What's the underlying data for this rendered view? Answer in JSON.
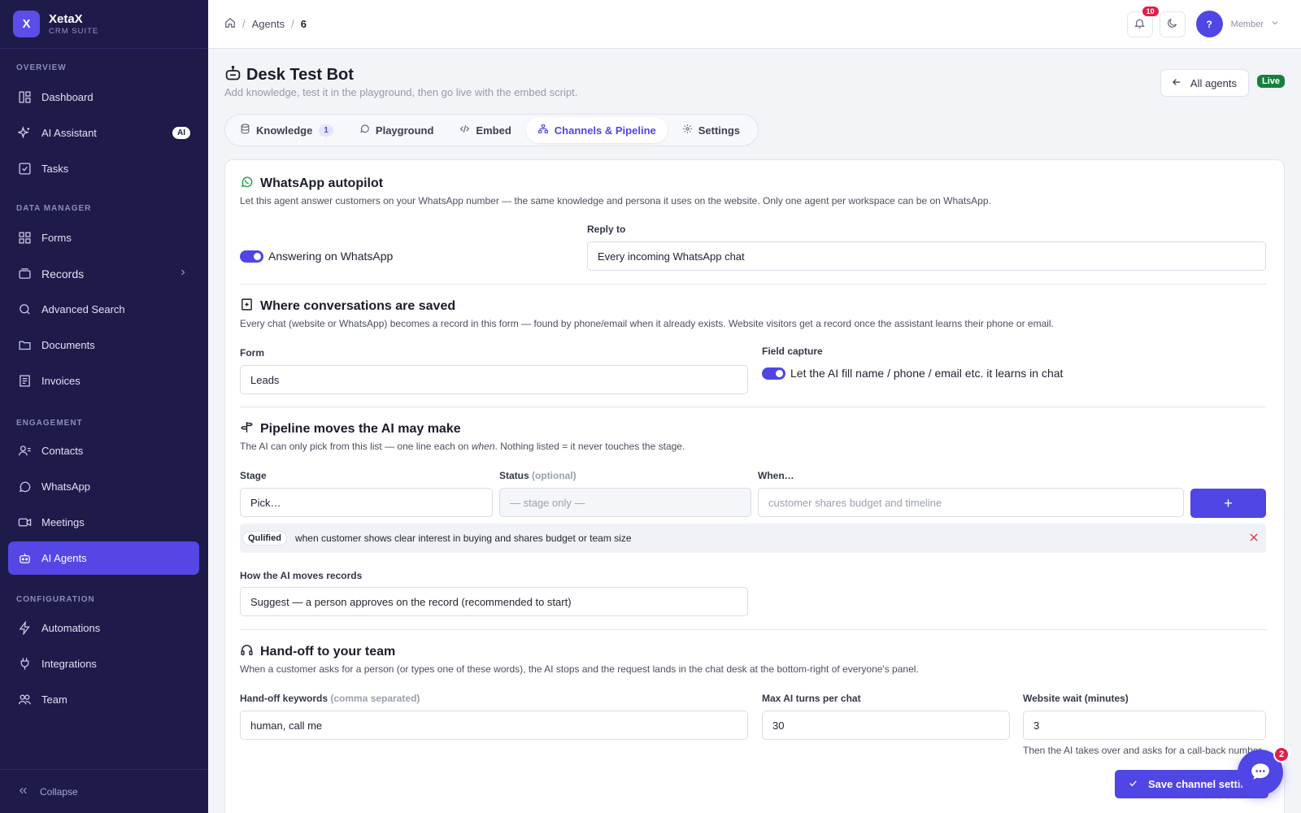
{
  "brand": {
    "logo_letter": "X",
    "name": "XetaX",
    "subtitle": "CRM SUITE"
  },
  "sidebar": {
    "sections": [
      {
        "label": "OVERVIEW"
      },
      {
        "label": "DATA MANAGER"
      },
      {
        "label": "ENGAGEMENT"
      },
      {
        "label": "CONFIGURATION"
      }
    ],
    "items": [
      {
        "label": "Dashboard",
        "icon": "dashboard-icon"
      },
      {
        "label": "AI Assistant",
        "icon": "sparkles-icon",
        "badge": "AI"
      },
      {
        "label": "Tasks",
        "icon": "checkbox-icon"
      },
      {
        "label": "Forms",
        "icon": "forms-icon"
      },
      {
        "label": "Records",
        "icon": "records-icon"
      },
      {
        "label": "Advanced Search",
        "icon": "search-icon"
      },
      {
        "label": "Documents",
        "icon": "folder-icon"
      },
      {
        "label": "Invoices",
        "icon": "invoice-icon"
      },
      {
        "label": "Contacts",
        "icon": "contacts-icon"
      },
      {
        "label": "WhatsApp",
        "icon": "whatsapp-icon"
      },
      {
        "label": "Meetings",
        "icon": "video-icon"
      },
      {
        "label": "AI Agents",
        "icon": "robot-icon",
        "active": true
      },
      {
        "label": "Automations",
        "icon": "bolt-icon"
      },
      {
        "label": "Integrations",
        "icon": "plug-icon"
      },
      {
        "label": "Team",
        "icon": "team-icon"
      }
    ],
    "collapse_label": "Collapse"
  },
  "topbar": {
    "breadcrumb": [
      "Agents",
      "6"
    ],
    "notifications_count": "10",
    "avatar_letter": "?",
    "role": "Member"
  },
  "page": {
    "title": "Desk Test Bot",
    "subtitle": "Add knowledge, test it in the playground, then go live with the embed script.",
    "all_agents_label": "All agents",
    "status": "Live",
    "tabs": [
      {
        "label": "Knowledge",
        "count": "1",
        "icon": "database-icon"
      },
      {
        "label": "Playground",
        "icon": "chat-bubble-icon"
      },
      {
        "label": "Embed",
        "icon": "code-icon"
      },
      {
        "label": "Channels & Pipeline",
        "icon": "hierarchy-icon",
        "active": true
      },
      {
        "label": "Settings",
        "icon": "gear-icon"
      }
    ]
  },
  "whatsapp": {
    "title": "WhatsApp autopilot",
    "description": "Let this agent answer customers on your WhatsApp number — the same knowledge and persona it uses on the website. Only one agent per workspace can be on WhatsApp.",
    "toggle_label": "Answering on WhatsApp",
    "toggle_on": true,
    "reply_to_label": "Reply to",
    "reply_to_value": "Every incoming WhatsApp chat"
  },
  "conversations": {
    "title": "Where conversations are saved",
    "description": "Every chat (website or WhatsApp) becomes a record in this form — found by phone/email when it already exists. Website visitors get a record once the assistant learns their phone or email.",
    "form_label": "Form",
    "form_value": "Leads",
    "field_capture_label": "Field capture",
    "field_capture_toggle_label": "Let the AI fill name / phone / email etc. it learns in chat",
    "field_capture_on": true
  },
  "pipeline": {
    "title": "Pipeline moves the AI may make",
    "description_pre": "The AI can only pick from this list — one line each on ",
    "description_em": "when",
    "description_post": ". Nothing listed = it never touches the stage.",
    "stage_label": "Stage",
    "stage_value": "Pick…",
    "status_label": "Status",
    "status_optional": "(optional)",
    "status_placeholder": "— stage only —",
    "when_label": "When…",
    "when_placeholder": "customer shares budget and timeline",
    "add_label": "+",
    "rules": [
      {
        "stage": "Qulified",
        "when": "when customer shows clear interest in buying and shares budget or team size"
      }
    ],
    "moves_label": "How the AI moves records",
    "moves_value": "Suggest — a person approves on the record (recommended to start)"
  },
  "handoff": {
    "title": "Hand-off to your team",
    "description": "When a customer asks for a person (or types one of these words), the AI stops and the request lands in the chat desk at the bottom-right of everyone's panel.",
    "keywords_label": "Hand-off keywords",
    "keywords_hint": "(comma separated)",
    "keywords_value": "human, call me",
    "max_turns_label": "Max AI turns per chat",
    "max_turns_value": "30",
    "wait_label": "Website wait (minutes)",
    "wait_value": "3",
    "wait_help": "Then the AI takes over and asks for a call-back number."
  },
  "save_label": "Save channel settings",
  "chat_fab_badge": "2",
  "colors": {
    "accent": "#4f46e5",
    "sidebar_bg": "#1e1b4b",
    "live": "#15803d",
    "danger": "#e11d48",
    "whatsapp": "#16a34a"
  }
}
